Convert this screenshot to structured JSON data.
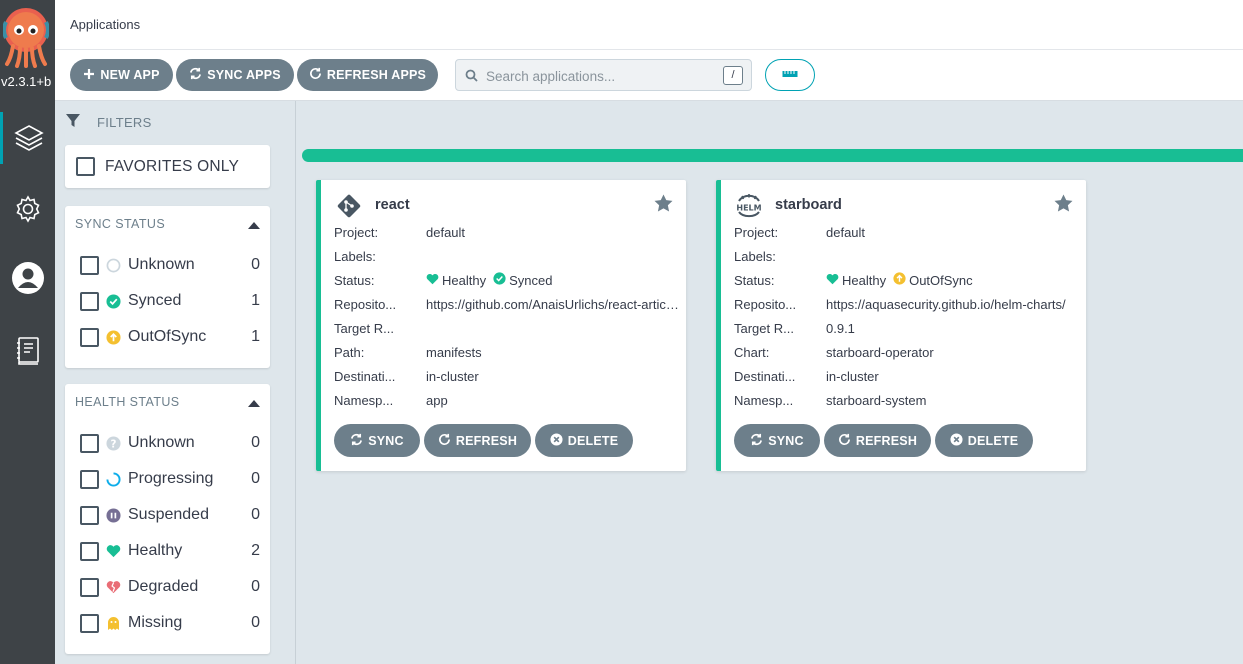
{
  "app": {
    "version": "v2.3.1+b",
    "title": "Applications"
  },
  "colors": {
    "accent": "#00a2b3",
    "healthy": "#18be94",
    "button": "#6d7f8b",
    "outOfSync": "#f4c030",
    "degraded": "#e96d76",
    "suspended": "#766f94"
  },
  "nav": {
    "items": [
      {
        "name": "applications",
        "icon": "layers-icon"
      },
      {
        "name": "settings",
        "icon": "gear-icon"
      },
      {
        "name": "user-info",
        "icon": "user-icon"
      },
      {
        "name": "documentation",
        "icon": "book-icon"
      }
    ]
  },
  "toolbar": {
    "new_app": "NEW APP",
    "sync_apps": "SYNC APPS",
    "refresh_apps": "REFRESH APPS",
    "search_placeholder": "Search applications...",
    "search_shortcut": "/"
  },
  "filters": {
    "title": "FILTERS",
    "favorites_only": "FAVORITES ONLY",
    "sync_status": {
      "title": "SYNC STATUS",
      "items": [
        {
          "label": "Unknown",
          "count": "0"
        },
        {
          "label": "Synced",
          "count": "1"
        },
        {
          "label": "OutOfSync",
          "count": "1"
        }
      ]
    },
    "health_status": {
      "title": "HEALTH STATUS",
      "items": [
        {
          "label": "Unknown",
          "count": "0"
        },
        {
          "label": "Progressing",
          "count": "0"
        },
        {
          "label": "Suspended",
          "count": "0"
        },
        {
          "label": "Healthy",
          "count": "2"
        },
        {
          "label": "Degraded",
          "count": "0"
        },
        {
          "label": "Missing",
          "count": "0"
        }
      ]
    }
  },
  "apps": [
    {
      "name": "react",
      "source_icon": "git-icon",
      "fields": [
        {
          "key": "Project:",
          "value": "default"
        },
        {
          "key": "Labels:",
          "value": ""
        },
        {
          "key": "Status:",
          "health": "Healthy",
          "sync": "Synced"
        },
        {
          "key": "Reposito...",
          "value": "https://github.com/AnaisUrlichs/react-article-test-app"
        },
        {
          "key": "Target R...",
          "value": ""
        },
        {
          "key": "Path:",
          "value": "manifests"
        },
        {
          "key": "Destinati...",
          "value": "in-cluster"
        },
        {
          "key": "Namesp...",
          "value": "app"
        }
      ],
      "actions": {
        "sync": "SYNC",
        "refresh": "REFRESH",
        "delete": "DELETE"
      }
    },
    {
      "name": "starboard",
      "source_icon": "helm-icon",
      "fields": [
        {
          "key": "Project:",
          "value": "default"
        },
        {
          "key": "Labels:",
          "value": ""
        },
        {
          "key": "Status:",
          "health": "Healthy",
          "sync": "OutOfSync"
        },
        {
          "key": "Reposito...",
          "value": "https://aquasecurity.github.io/helm-charts/"
        },
        {
          "key": "Target R...",
          "value": "0.9.1"
        },
        {
          "key": "Chart:",
          "value": "starboard-operator"
        },
        {
          "key": "Destinati...",
          "value": "in-cluster"
        },
        {
          "key": "Namesp...",
          "value": "starboard-system"
        }
      ],
      "actions": {
        "sync": "SYNC",
        "refresh": "REFRESH",
        "delete": "DELETE"
      }
    }
  ]
}
